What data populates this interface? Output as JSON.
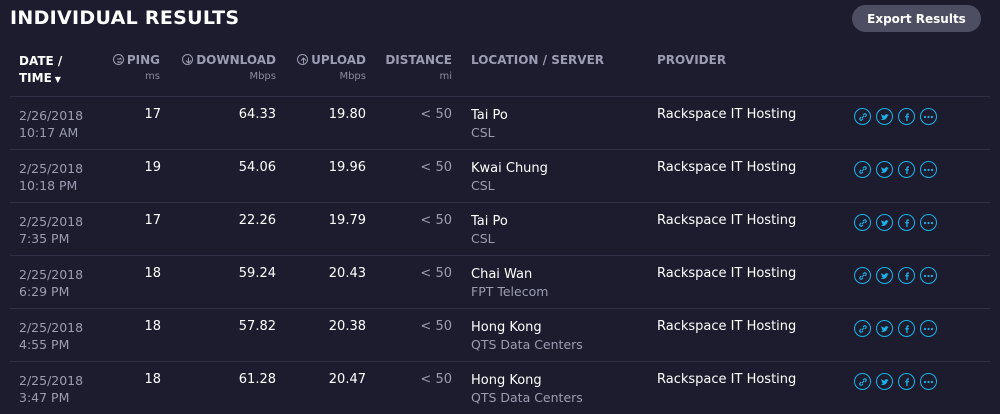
{
  "page": {
    "title": "INDIVIDUAL RESULTS",
    "export_label": "Export Results"
  },
  "columns": {
    "date": {
      "line1": "DATE /",
      "line2": "TIME",
      "sort": "▼"
    },
    "ping": {
      "label": "PING",
      "unit": "ms"
    },
    "download": {
      "label": "DOWNLOAD",
      "unit": "Mbps"
    },
    "upload": {
      "label": "UPLOAD",
      "unit": "Mbps"
    },
    "distance": {
      "label": "DISTANCE",
      "unit": "mi"
    },
    "location": {
      "label": "LOCATION / SERVER"
    },
    "provider": {
      "label": "PROVIDER"
    }
  },
  "rows": [
    {
      "date": "2/26/2018",
      "time": "10:17 AM",
      "ping": "17",
      "download": "64.33",
      "upload": "19.80",
      "distance": "< 50",
      "location": "Tai Po",
      "server": "CSL",
      "provider": "Rackspace IT Hosting"
    },
    {
      "date": "2/25/2018",
      "time": "10:18 PM",
      "ping": "19",
      "download": "54.06",
      "upload": "19.96",
      "distance": "< 50",
      "location": "Kwai Chung",
      "server": "CSL",
      "provider": "Rackspace IT Hosting"
    },
    {
      "date": "2/25/2018",
      "time": "7:35 PM",
      "ping": "17",
      "download": "22.26",
      "upload": "19.79",
      "distance": "< 50",
      "location": "Tai Po",
      "server": "CSL",
      "provider": "Rackspace IT Hosting"
    },
    {
      "date": "2/25/2018",
      "time": "6:29 PM",
      "ping": "18",
      "download": "59.24",
      "upload": "20.43",
      "distance": "< 50",
      "location": "Chai Wan",
      "server": "FPT Telecom",
      "provider": "Rackspace IT Hosting"
    },
    {
      "date": "2/25/2018",
      "time": "4:55 PM",
      "ping": "18",
      "download": "57.82",
      "upload": "20.38",
      "distance": "< 50",
      "location": "Hong Kong",
      "server": "QTS Data Centers",
      "provider": "Rackspace IT Hosting"
    },
    {
      "date": "2/25/2018",
      "time": "3:47 PM",
      "ping": "18",
      "download": "61.28",
      "upload": "20.47",
      "distance": "< 50",
      "location": "Hong Kong",
      "server": "QTS Data Centers",
      "provider": "Rackspace IT Hosting"
    }
  ],
  "row_actions": [
    "link-icon",
    "twitter-icon",
    "facebook-icon",
    "more-icon"
  ],
  "colors": {
    "background": "#1c1c2e",
    "accent": "#1ab2ea",
    "muted": "#9c9cb3",
    "button": "#4e4e63"
  }
}
